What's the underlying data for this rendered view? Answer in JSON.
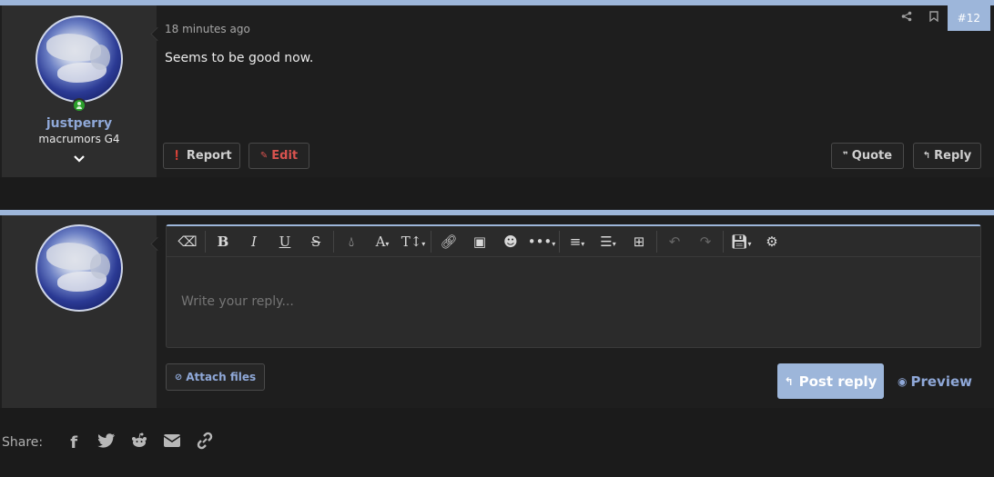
{
  "post": {
    "timestamp": "18 minutes ago",
    "post_number": "#12",
    "message": "Seems to be good now.",
    "author": {
      "username": "justperry",
      "title": "macrumors G4",
      "online": true
    },
    "actions": {
      "report_label": "Report",
      "edit_label": "Edit",
      "quote_label": "Quote",
      "reply_label": "Reply"
    },
    "top_icons": [
      "share-icon",
      "bookmark-icon"
    ]
  },
  "reply_form": {
    "placeholder": "Write your reply...",
    "toolbar": [
      "eraser-icon",
      "bold-icon",
      "italic-icon",
      "underline-icon",
      "strikethrough-icon",
      "text-color-icon",
      "font-family-icon",
      "font-size-icon",
      "link-icon",
      "image-icon",
      "smilie-icon",
      "more-icon",
      "align-icon",
      "list-icon",
      "table-icon",
      "undo-icon",
      "redo-icon",
      "drafts-icon",
      "settings-icon"
    ],
    "attach_label": "Attach files",
    "post_reply_label": "Post reply",
    "preview_label": "Preview"
  },
  "share": {
    "label": "Share:",
    "icons": [
      "facebook-icon",
      "twitter-icon",
      "reddit-icon",
      "email-icon",
      "link-icon"
    ]
  },
  "colors": {
    "accent": "#9db6da",
    "username": "#8fa8d8",
    "edit": "#d9534f",
    "online": "#2ba02b"
  }
}
